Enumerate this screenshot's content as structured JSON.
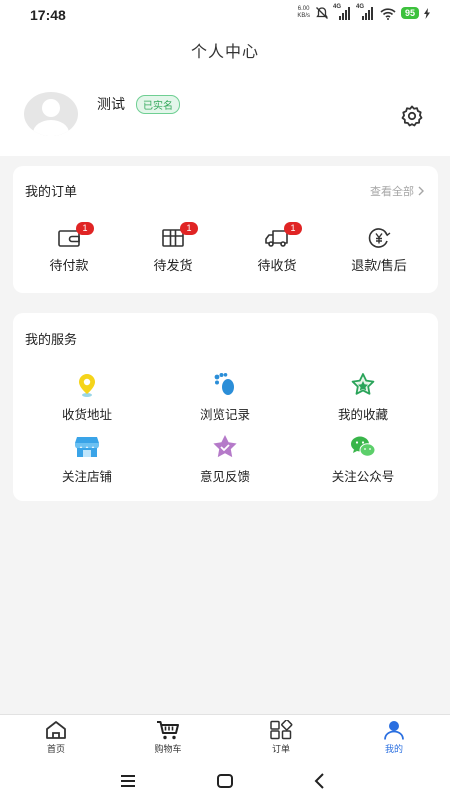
{
  "status_bar": {
    "time": "17:48",
    "net_speed_value": "6.00",
    "net_speed_unit": "KB/s",
    "network_1": "4G",
    "network_2": "4G",
    "battery": "95"
  },
  "header": {
    "title": "个人中心"
  },
  "profile": {
    "username": "测试",
    "verified_badge": "已实名"
  },
  "orders": {
    "title": "我的订单",
    "view_all": "查看全部",
    "items": [
      {
        "label": "待付款",
        "icon": "wallet-icon",
        "badge": "1"
      },
      {
        "label": "待发货",
        "icon": "package-icon",
        "badge": "1"
      },
      {
        "label": "待收货",
        "icon": "truck-icon",
        "badge": "1"
      },
      {
        "label": "退款/售后",
        "icon": "refund-icon",
        "badge": ""
      }
    ]
  },
  "services": {
    "title": "我的服务",
    "items": [
      {
        "label": "收货地址",
        "icon": "location-pin-icon"
      },
      {
        "label": "浏览记录",
        "icon": "footprint-icon"
      },
      {
        "label": "我的收藏",
        "icon": "star-icon"
      },
      {
        "label": "关注店铺",
        "icon": "store-icon"
      },
      {
        "label": "意见反馈",
        "icon": "feedback-star-icon"
      },
      {
        "label": "关注公众号",
        "icon": "wechat-icon"
      }
    ]
  },
  "tabbar": {
    "items": [
      {
        "label": "首页",
        "icon": "home-icon"
      },
      {
        "label": "购物车",
        "icon": "cart-icon"
      },
      {
        "label": "订单",
        "icon": "orders-grid-icon"
      },
      {
        "label": "我的",
        "icon": "user-icon",
        "active": true
      }
    ]
  },
  "colors": {
    "accent": "#2a6fe0",
    "badge": "#e02424",
    "verified": "#35a85c",
    "page_bg": "#f4f4f4"
  }
}
